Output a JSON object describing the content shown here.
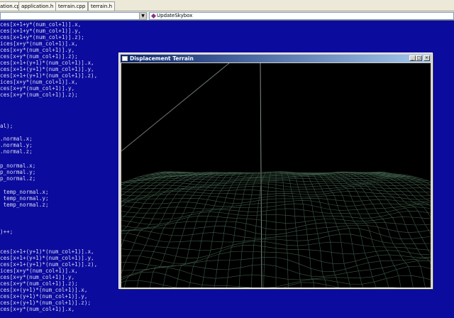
{
  "tabs": [
    "ation.cpp",
    "application.h",
    "terrain.cpp",
    "terrain.h"
  ],
  "combos": {
    "scope": "",
    "function": "UpdateSkybox"
  },
  "code_lines": [
    "ces[x+1+y*(num_col+1)].x,",
    "ces[x+1+y*(num_col+1)].y,",
    "ces[x+1+y*(num_col+1)].z);",
    "ices[x+y*(num_col+1)].x,",
    "ces[x+y*(num_col+1)].y,",
    "ces[x+y*(num_col+1)].z);",
    "ces[x+1+(y+1)*(num_col+1)].x,",
    "ces[x+1+(y+1)*(num_col+1)].y,",
    "ces[x+1+(y+1)*(num_col+1)].z),",
    "ices[x+y*(num_col+1)].x,",
    "ces[x+y*(num_col+1)].y,",
    "ces[x+y*(num_col+1)].z);",
    "al);",
    ".normal.x;",
    ".normal.y;",
    ".normal.z;",
    "p_normal.x;",
    "p_normal.y;",
    "p_normal.z;",
    " temp_normal.x;",
    " temp_normal.y;",
    " temp_normal.z;",
    ")++;",
    "ces[x+1+(y+1)*(num_col+1)].x,",
    "ces[x+1+(y+1)*(num_col+1)].y,",
    "ces[x+1+(y+1)*(num_col+1)].z),",
    "ices[x+y*(num_col+1)].x,",
    "ces[x+y*(num_col+1)].y,",
    "ces[x+y*(num_col+1)].z);",
    "ces[x+(y+1)*(num_col+1)].x,",
    "ces[x+(y+1)*(num_col+1)].y,",
    "ces[x+(y+1)*(num_col+1)].z);",
    "ces[x+y*(num_col+1)].x,"
  ],
  "window": {
    "title": "Displacement Terrain",
    "buttons": [
      "minimize",
      "maximize",
      "close"
    ]
  },
  "colors": {
    "editor_bg": "#0b0b9e",
    "code_text": "#dcdcf4",
    "wire": "#3c5a46",
    "titlebar_start": "#0a246a",
    "titlebar_end": "#a6caf0"
  }
}
